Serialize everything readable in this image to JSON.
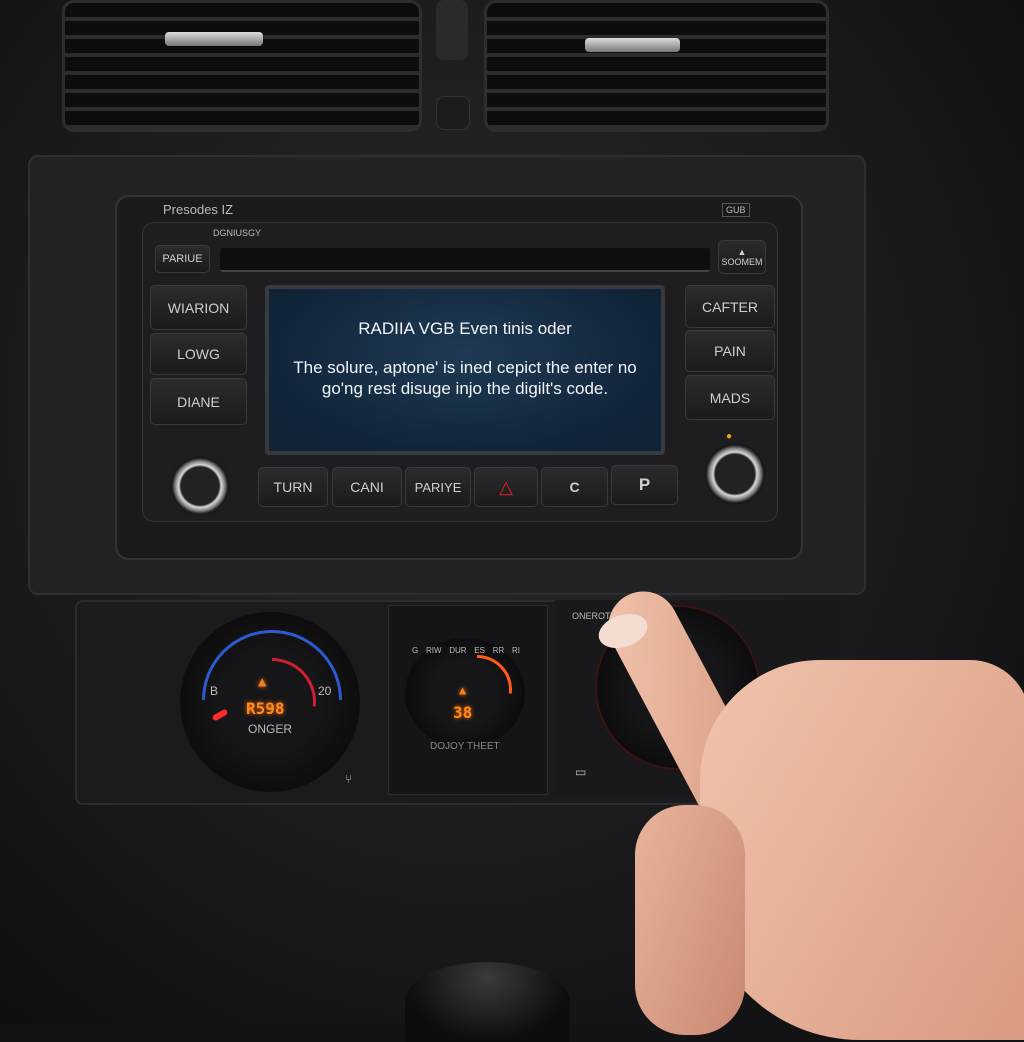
{
  "radio": {
    "brand_label": "Presodes IZ",
    "top_right_badge": "GUB",
    "slot_label": "DGNIUSGY",
    "top_left_button": "PARIUE",
    "eject_label": "SOOMEM",
    "left_buttons": [
      "WIARION",
      "LOWG",
      "DIANE"
    ],
    "right_buttons": [
      "CAFTER",
      "PAIN",
      "MADS"
    ],
    "bottom_buttons": [
      "TURN",
      "CANI",
      "PARIYE"
    ],
    "hazard_icon": "warning-triangle-icon",
    "c_button": "C",
    "p_button": "P",
    "screen": {
      "title": "RADIIA VGB Even tinis oder",
      "message": "The solure, aptone' is ined cepict the enter no go'ng rest disuge injo the digilt's code."
    }
  },
  "climate": {
    "left_dial": {
      "min_label": "B",
      "max_label": "20",
      "display": "R598",
      "label": "ONGER"
    },
    "center_dial": {
      "scale": [
        "G",
        "RIW",
        "DUR",
        "ES",
        "RR",
        "RI"
      ],
      "display": "38",
      "label": "DOJOY THEET"
    },
    "right_label": "ONEROT",
    "icons": [
      "seat-icon",
      "radio-icon"
    ]
  },
  "colors": {
    "screen": "#15304a",
    "lcd": "#ff8a1e",
    "hazard": "#e02020"
  }
}
